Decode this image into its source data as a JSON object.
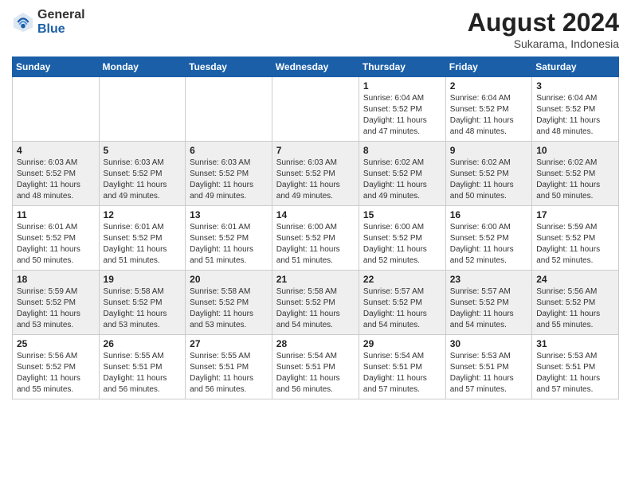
{
  "header": {
    "logo_general": "General",
    "logo_blue": "Blue",
    "month_year": "August 2024",
    "location": "Sukarama, Indonesia"
  },
  "days_of_week": [
    "Sunday",
    "Monday",
    "Tuesday",
    "Wednesday",
    "Thursday",
    "Friday",
    "Saturday"
  ],
  "weeks": [
    [
      {
        "day": "",
        "info": ""
      },
      {
        "day": "",
        "info": ""
      },
      {
        "day": "",
        "info": ""
      },
      {
        "day": "",
        "info": ""
      },
      {
        "day": "1",
        "info": "Sunrise: 6:04 AM\nSunset: 5:52 PM\nDaylight: 11 hours\nand 47 minutes."
      },
      {
        "day": "2",
        "info": "Sunrise: 6:04 AM\nSunset: 5:52 PM\nDaylight: 11 hours\nand 48 minutes."
      },
      {
        "day": "3",
        "info": "Sunrise: 6:04 AM\nSunset: 5:52 PM\nDaylight: 11 hours\nand 48 minutes."
      }
    ],
    [
      {
        "day": "4",
        "info": "Sunrise: 6:03 AM\nSunset: 5:52 PM\nDaylight: 11 hours\nand 48 minutes."
      },
      {
        "day": "5",
        "info": "Sunrise: 6:03 AM\nSunset: 5:52 PM\nDaylight: 11 hours\nand 49 minutes."
      },
      {
        "day": "6",
        "info": "Sunrise: 6:03 AM\nSunset: 5:52 PM\nDaylight: 11 hours\nand 49 minutes."
      },
      {
        "day": "7",
        "info": "Sunrise: 6:03 AM\nSunset: 5:52 PM\nDaylight: 11 hours\nand 49 minutes."
      },
      {
        "day": "8",
        "info": "Sunrise: 6:02 AM\nSunset: 5:52 PM\nDaylight: 11 hours\nand 49 minutes."
      },
      {
        "day": "9",
        "info": "Sunrise: 6:02 AM\nSunset: 5:52 PM\nDaylight: 11 hours\nand 50 minutes."
      },
      {
        "day": "10",
        "info": "Sunrise: 6:02 AM\nSunset: 5:52 PM\nDaylight: 11 hours\nand 50 minutes."
      }
    ],
    [
      {
        "day": "11",
        "info": "Sunrise: 6:01 AM\nSunset: 5:52 PM\nDaylight: 11 hours\nand 50 minutes."
      },
      {
        "day": "12",
        "info": "Sunrise: 6:01 AM\nSunset: 5:52 PM\nDaylight: 11 hours\nand 51 minutes."
      },
      {
        "day": "13",
        "info": "Sunrise: 6:01 AM\nSunset: 5:52 PM\nDaylight: 11 hours\nand 51 minutes."
      },
      {
        "day": "14",
        "info": "Sunrise: 6:00 AM\nSunset: 5:52 PM\nDaylight: 11 hours\nand 51 minutes."
      },
      {
        "day": "15",
        "info": "Sunrise: 6:00 AM\nSunset: 5:52 PM\nDaylight: 11 hours\nand 52 minutes."
      },
      {
        "day": "16",
        "info": "Sunrise: 6:00 AM\nSunset: 5:52 PM\nDaylight: 11 hours\nand 52 minutes."
      },
      {
        "day": "17",
        "info": "Sunrise: 5:59 AM\nSunset: 5:52 PM\nDaylight: 11 hours\nand 52 minutes."
      }
    ],
    [
      {
        "day": "18",
        "info": "Sunrise: 5:59 AM\nSunset: 5:52 PM\nDaylight: 11 hours\nand 53 minutes."
      },
      {
        "day": "19",
        "info": "Sunrise: 5:58 AM\nSunset: 5:52 PM\nDaylight: 11 hours\nand 53 minutes."
      },
      {
        "day": "20",
        "info": "Sunrise: 5:58 AM\nSunset: 5:52 PM\nDaylight: 11 hours\nand 53 minutes."
      },
      {
        "day": "21",
        "info": "Sunrise: 5:58 AM\nSunset: 5:52 PM\nDaylight: 11 hours\nand 54 minutes."
      },
      {
        "day": "22",
        "info": "Sunrise: 5:57 AM\nSunset: 5:52 PM\nDaylight: 11 hours\nand 54 minutes."
      },
      {
        "day": "23",
        "info": "Sunrise: 5:57 AM\nSunset: 5:52 PM\nDaylight: 11 hours\nand 54 minutes."
      },
      {
        "day": "24",
        "info": "Sunrise: 5:56 AM\nSunset: 5:52 PM\nDaylight: 11 hours\nand 55 minutes."
      }
    ],
    [
      {
        "day": "25",
        "info": "Sunrise: 5:56 AM\nSunset: 5:52 PM\nDaylight: 11 hours\nand 55 minutes."
      },
      {
        "day": "26",
        "info": "Sunrise: 5:55 AM\nSunset: 5:51 PM\nDaylight: 11 hours\nand 56 minutes."
      },
      {
        "day": "27",
        "info": "Sunrise: 5:55 AM\nSunset: 5:51 PM\nDaylight: 11 hours\nand 56 minutes."
      },
      {
        "day": "28",
        "info": "Sunrise: 5:54 AM\nSunset: 5:51 PM\nDaylight: 11 hours\nand 56 minutes."
      },
      {
        "day": "29",
        "info": "Sunrise: 5:54 AM\nSunset: 5:51 PM\nDaylight: 11 hours\nand 57 minutes."
      },
      {
        "day": "30",
        "info": "Sunrise: 5:53 AM\nSunset: 5:51 PM\nDaylight: 11 hours\nand 57 minutes."
      },
      {
        "day": "31",
        "info": "Sunrise: 5:53 AM\nSunset: 5:51 PM\nDaylight: 11 hours\nand 57 minutes."
      }
    ]
  ]
}
